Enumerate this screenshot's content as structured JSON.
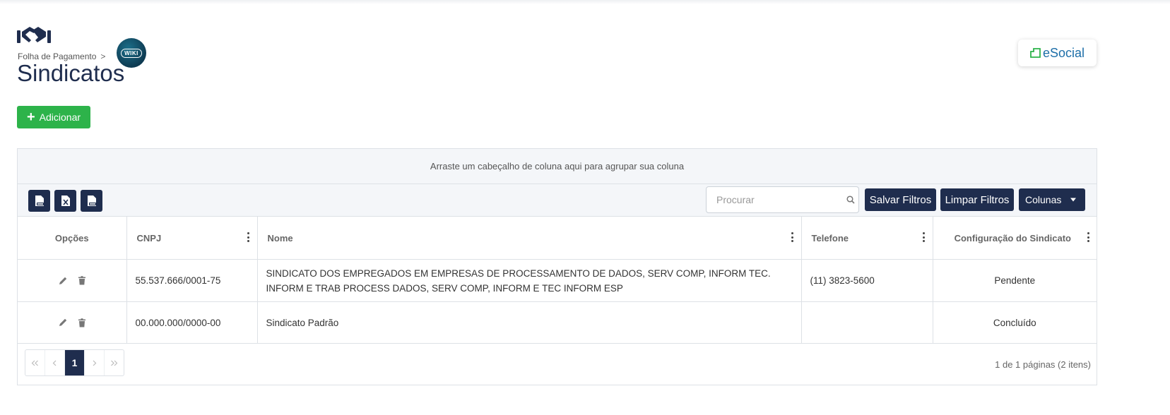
{
  "breadcrumb": {
    "parent": "Folha de Pagamento",
    "separator": ">"
  },
  "page": {
    "title": "Sindicatos"
  },
  "badges": {
    "wiki": "WIKI",
    "esocial": "eSocial"
  },
  "actions": {
    "add_label": "Adicionar"
  },
  "grid": {
    "group_hint": "Arraste um cabeçalho de coluna aqui para agrupar sua coluna",
    "search_placeholder": "Procurar",
    "save_filters": "Salvar Filtros",
    "clear_filters": "Limpar Filtros",
    "columns_menu": "Colunas",
    "columns": {
      "options": "Opções",
      "cnpj": "CNPJ",
      "name": "Nome",
      "phone": "Telefone",
      "config": "Configuração do Sindicato"
    },
    "rows": [
      {
        "cnpj": "55.537.666/0001-75",
        "name": "SINDICATO DOS EMPREGADOS EM EMPRESAS DE PROCESSAMENTO DE DADOS, SERV COMP, INFORM TEC. INFORM E TRAB PROCESS DADOS, SERV COMP, INFORM E TEC INFORM ESP",
        "phone": "(11) 3823-5600",
        "config": "Pendente"
      },
      {
        "cnpj": "00.000.000/0000-00",
        "name": "Sindicato Padrão",
        "phone": "",
        "config": "Concluído"
      }
    ],
    "pagination": {
      "current_page": "1",
      "info": "1 de 1 páginas (2 itens)"
    }
  },
  "colors": {
    "primary": "#1f2d4e",
    "success": "#2db34a",
    "border": "#dde1e6"
  }
}
